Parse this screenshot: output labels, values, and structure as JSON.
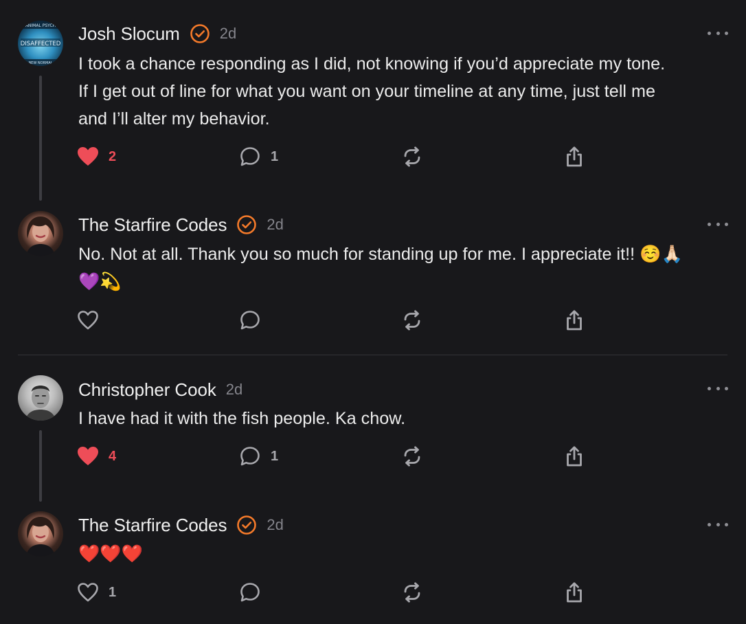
{
  "posts": [
    {
      "author": "Josh Slocum",
      "verified": true,
      "time": "2d",
      "avatar_text": "DISAFFECTED",
      "lines": [
        "I took a chance responding as I did, not knowing if you’d appreciate my tone.",
        "If I get out of line for what you want on your timeline at any time, just tell me",
        "and I’ll alter my behavior."
      ],
      "likes": "2",
      "liked": true,
      "comments": "1"
    },
    {
      "author": "The Starfire Codes",
      "verified": true,
      "time": "2d",
      "lines": [
        "No. Not at all. Thank you so much for standing up for me. I appreciate it!! ☺️🙏🏻",
        "💜💫"
      ],
      "likes": "",
      "liked": false,
      "comments": ""
    },
    {
      "author": "Christopher Cook",
      "verified": false,
      "time": "2d",
      "lines": [
        "I have had it with the fish people. Ka chow."
      ],
      "likes": "4",
      "liked": true,
      "comments": "1"
    },
    {
      "author": "The Starfire Codes",
      "verified": true,
      "time": "2d",
      "lines": [
        "❤️❤️❤️"
      ],
      "likes": "1",
      "liked": false,
      "comments": ""
    }
  ],
  "colors": {
    "background": "#18181b",
    "verified_orange": "#f47a2a",
    "like_red": "#ee4d58",
    "muted": "#85858c"
  }
}
